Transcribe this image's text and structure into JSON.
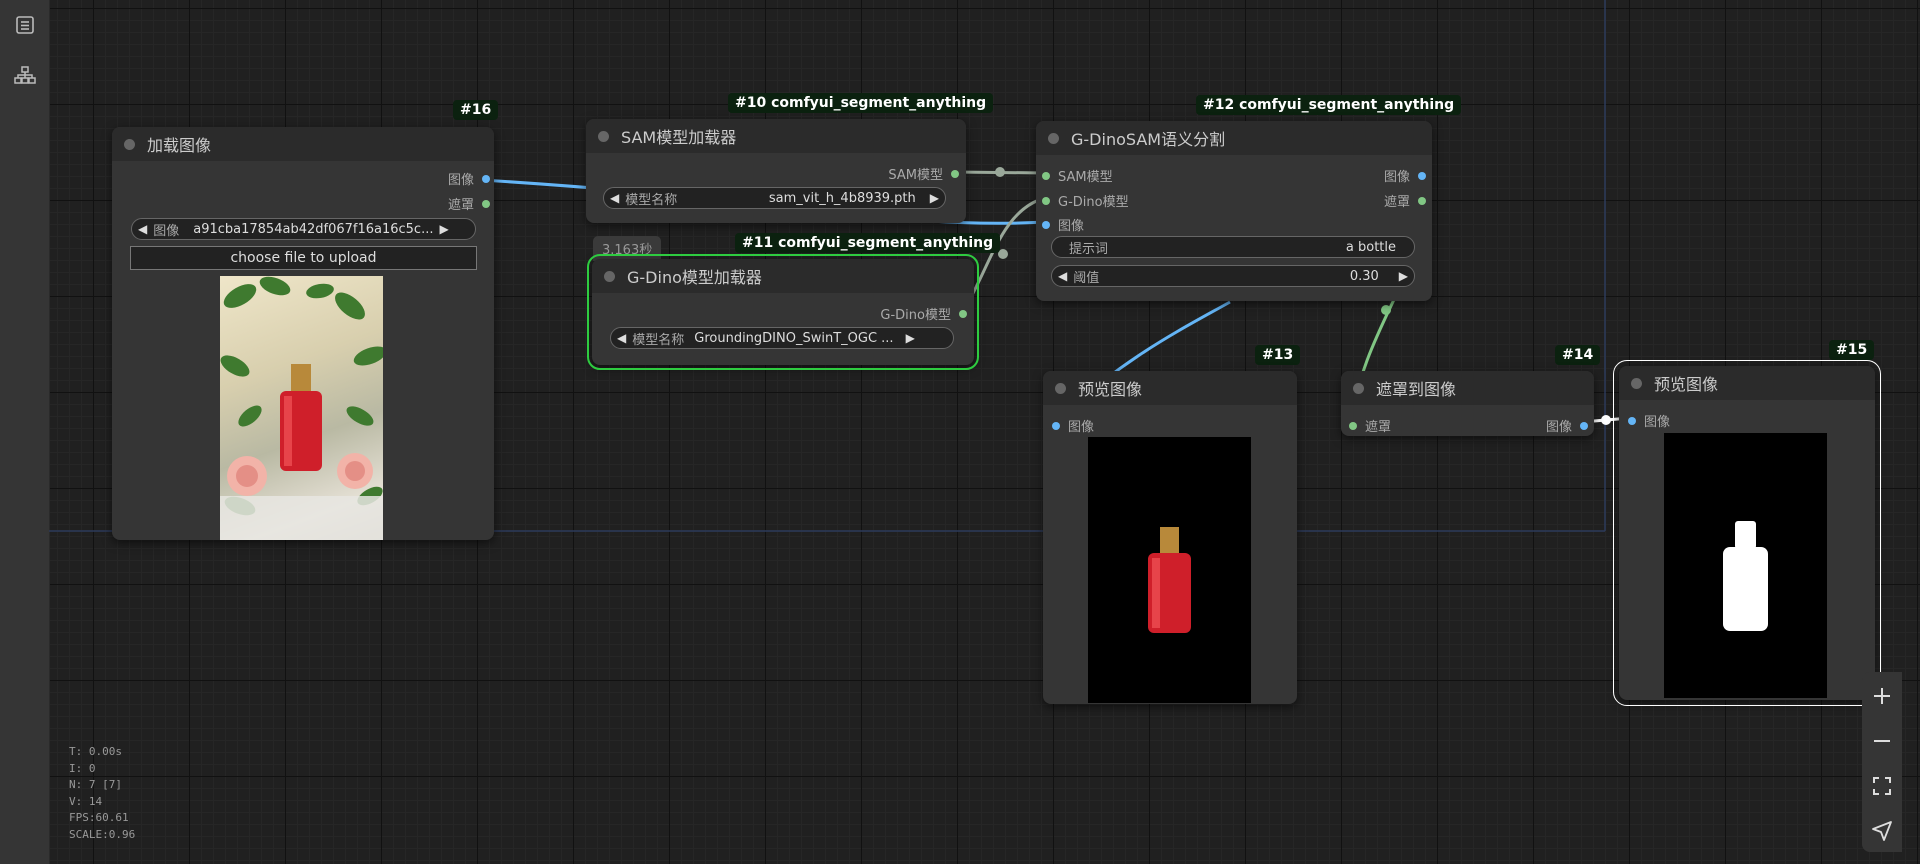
{
  "sidebar": {
    "items": [
      {
        "icon": "queue-list-icon"
      },
      {
        "icon": "node-tree-icon"
      }
    ]
  },
  "nodes": {
    "n16": {
      "badge": "#16",
      "title": "加载图像",
      "outputs": [
        {
          "label": "图像",
          "color": "#64b5f6"
        },
        {
          "label": "遮罩",
          "color": "#81c784"
        }
      ],
      "image_widget": {
        "label": "图像",
        "value": "a91cba17854ab42df067f16a16c5c..."
      },
      "upload_label": "choose file to upload"
    },
    "n10": {
      "badge": "#10 comfyui_segment_anything",
      "title": "SAM模型加载器",
      "outputs": [
        {
          "label": "SAM模型",
          "color": "#81c784"
        }
      ],
      "widget": {
        "label": "模型名称",
        "value": "sam_vit_h_4b8939.pth"
      }
    },
    "n11": {
      "badge": "#11 comfyui_segment_anything",
      "title": "G-Dino模型加载器",
      "timer": "3.163秒",
      "outputs": [
        {
          "label": "G-Dino模型",
          "color": "#81c784"
        }
      ],
      "widget": {
        "label": "模型名称",
        "value": "GroundingDINO_SwinT_OGC ..."
      }
    },
    "n12": {
      "badge": "#12 comfyui_segment_anything",
      "title": "G-DinoSAM语义分割",
      "inputs": [
        {
          "label": "SAM模型",
          "color": "#81c784"
        },
        {
          "label": "G-Dino模型",
          "color": "#81c784"
        },
        {
          "label": "图像",
          "color": "#64b5f6"
        }
      ],
      "outputs": [
        {
          "label": "图像",
          "color": "#64b5f6"
        },
        {
          "label": "遮罩",
          "color": "#81c784"
        }
      ],
      "prompt": {
        "label": "提示词",
        "value": "a bottle"
      },
      "threshold": {
        "label": "阈值",
        "value": "0.30"
      }
    },
    "n13": {
      "badge": "#13",
      "title": "预览图像",
      "inputs": [
        {
          "label": "图像",
          "color": "#64b5f6"
        }
      ]
    },
    "n14": {
      "badge": "#14",
      "title": "遮罩到图像",
      "inputs": [
        {
          "label": "遮罩",
          "color": "#81c784"
        }
      ],
      "outputs": [
        {
          "label": "图像",
          "color": "#64b5f6"
        }
      ]
    },
    "n15": {
      "badge": "#15",
      "title": "预览图像",
      "inputs": [
        {
          "label": "图像",
          "color": "#64b5f6"
        }
      ]
    }
  },
  "stats": {
    "t": "T: 0.00s",
    "i": "I: 0",
    "n": "N: 7 [7]",
    "v": "V: 14",
    "fps": "FPS:60.61",
    "scale": "SCALE:0.96"
  },
  "zoom_controls": [
    {
      "icon": "zoom-in-icon"
    },
    {
      "icon": "zoom-out-icon"
    },
    {
      "icon": "fit-view-icon"
    },
    {
      "icon": "locate-icon"
    }
  ],
  "colors": {
    "image_link": "#64b5f6",
    "mask_link": "#81c784",
    "model_link": "#9aa89a",
    "running_node": "#2ecc40",
    "selected_node": "#ffffff"
  }
}
